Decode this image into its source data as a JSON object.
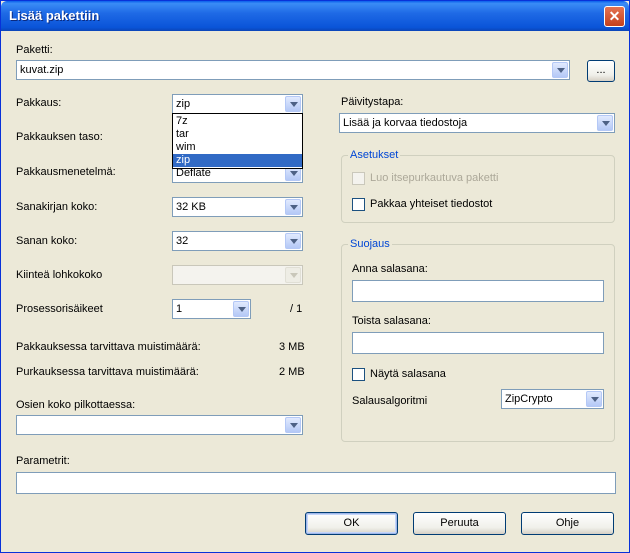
{
  "title": "Lisää pakettiin",
  "archive": {
    "label": "Paketti:",
    "value": "kuvat.zip",
    "browse": "..."
  },
  "left": {
    "format": {
      "label": "Pakkaus:",
      "value": "zip",
      "options": [
        "7z",
        "tar",
        "wim",
        "zip"
      ]
    },
    "level": {
      "label": "Pakkauksen taso:"
    },
    "method": {
      "label": "Pakkausmenetelmä:",
      "value": "Deflate"
    },
    "dict": {
      "label": "Sanakirjan koko:",
      "value": "32 KB"
    },
    "word": {
      "label": "Sanan koko:",
      "value": "32"
    },
    "solid": {
      "label": "Kiinteä lohkokoko",
      "value": ""
    },
    "threads": {
      "label": "Prosessorisäikeet",
      "value": "1",
      "max": "/ 1"
    },
    "mem_compress": {
      "label": "Pakkauksessa tarvittava muistimäärä:",
      "value": "3 MB"
    },
    "mem_decompress": {
      "label": "Purkauksessa tarvittava muistimäärä:",
      "value": "2 MB"
    },
    "split": {
      "label": "Osien koko pilkottaessa:",
      "value": ""
    }
  },
  "params": {
    "label": "Parametrit:",
    "value": ""
  },
  "right": {
    "update": {
      "label": "Päivitystapa:",
      "value": "Lisää ja korvaa tiedostoja"
    },
    "settings": {
      "title": "Asetukset",
      "sfx": "Luo itsepurkautuva paketti",
      "shared": "Pakkaa yhteiset tiedostot"
    },
    "security": {
      "title": "Suojaus",
      "enter_pw": "Anna salasana:",
      "repeat_pw": "Toista salasana:",
      "show_pw": "Näytä salasana",
      "algo_label": "Salausalgoritmi",
      "algo_value": "ZipCrypto"
    }
  },
  "buttons": {
    "ok": "OK",
    "cancel": "Peruuta",
    "help": "Ohje"
  },
  "icons": {
    "close": "close-icon"
  }
}
